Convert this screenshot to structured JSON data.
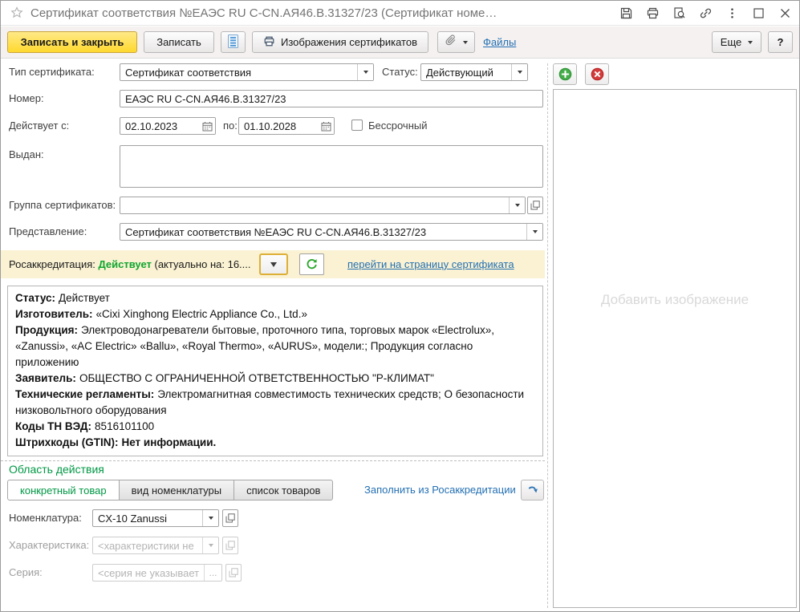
{
  "colors": {
    "primary_button": "#ffd92e",
    "link": "#2470b3",
    "status_green": "#11a52f",
    "section_green": "#009845",
    "ribbon_bg": "#faf2d3"
  },
  "icons": {
    "favorite_star": "star-outline",
    "save": "floppy-disk",
    "print": "printer",
    "preview": "document-magnifier",
    "link": "chain",
    "more": "vertical-dots",
    "maximize": "square",
    "close": "x",
    "report": "blue-list-document",
    "attach": "paperclip",
    "add": "green-plus-circle",
    "delete": "red-x-circle",
    "refresh": "green-refresh-arrow",
    "fill_arrow": "blue-curved-arrow",
    "calendar": "calendar-grid",
    "open": "overlapping-squares",
    "dropdown": "triangle-down"
  },
  "titlebar": {
    "title": "Сертификат соответствия №ЕАЭС RU C-CN.АЯ46.В.31327/23 (Сертификат номе…"
  },
  "toolbar": {
    "save_close": "Записать и закрыть",
    "save": "Записать",
    "images_button": "Изображения сертификатов",
    "files_link": "Файлы",
    "more": "Еще",
    "help": "?"
  },
  "form": {
    "type": {
      "label": "Тип сертификата:",
      "value": "Сертификат соответствия"
    },
    "status": {
      "label": "Статус:",
      "value": "Действующий"
    },
    "number": {
      "label": "Номер:",
      "value": "ЕАЭС RU C-CN.АЯ46.В.31327/23"
    },
    "valid_from": {
      "label": "Действует с:",
      "value": "02.10.2023"
    },
    "valid_to": {
      "label": "по:",
      "value": "01.10.2028"
    },
    "perpetual": {
      "label": "Бессрочный"
    },
    "issued_by": {
      "label": "Выдан:",
      "value": ""
    },
    "group": {
      "label": "Группа сертификатов:",
      "value": ""
    },
    "presentation": {
      "label": "Представление:",
      "value": "Сертификат соответствия №ЕАЭС RU C-CN.АЯ46.В.31327/23"
    }
  },
  "accreditation": {
    "label": "Росаккредитация:",
    "status": "Действует",
    "actual": "(актуально на: 16....",
    "link": "перейти на страницу сертификата"
  },
  "info": {
    "status": {
      "label": "Статус:",
      "value": "Действует"
    },
    "manufacturer": {
      "label": "Изготовитель:",
      "value": "«Cixi Xinghong Electric Appliance Co., Ltd.»"
    },
    "products": {
      "label": "Продукция:",
      "value": "Электроводонагреватели бытовые, проточного типа, торговых марок «Electrolux», «Zanussi», «AC Electric» «Ballu», «Royal Thermo», «AURUS», модели:; Продукция согласно приложению"
    },
    "applicant": {
      "label": "Заявитель:",
      "value": "ОБЩЕСТВО С ОГРАНИЧЕННОЙ ОТВЕТСТВЕННОСТЬЮ \"Р-КЛИМАТ\""
    },
    "regulations": {
      "label": "Технические регламенты:",
      "value": "Электромагнитная совместимость технических средств; О безопасности низковольтного оборудования"
    },
    "tnved": {
      "label": "Коды ТН ВЭД:",
      "value": "8516101100"
    },
    "gtin": {
      "label": "Штрихкоды (GTIN):",
      "value": "Нет информации."
    }
  },
  "scope": {
    "title": "Область действия",
    "tabs": [
      "конкретный товар",
      "вид номенклатуры",
      "список товаров"
    ],
    "fill_link": "Заполнить из Росаккредитации",
    "nomenclature": {
      "label": "Номенклатура:",
      "value": "CX-10 Zanussi"
    },
    "characteristic": {
      "label": "Характеристика:",
      "placeholder": "<характеристики не ис..."
    },
    "series": {
      "label": "Серия:",
      "placeholder": "<серия не указывается>",
      "more_label": "..."
    }
  },
  "panel": {
    "placeholder": "Добавить изображение"
  }
}
